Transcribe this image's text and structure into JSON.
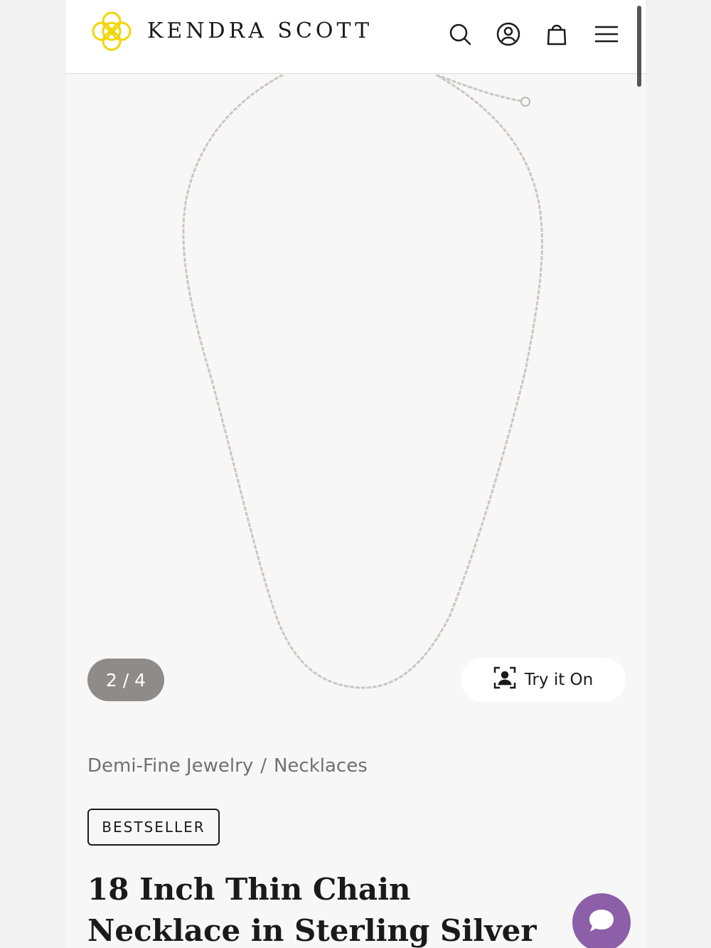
{
  "header": {
    "brand": "KENDRA SCOTT",
    "logo_color": "#f2d600",
    "icons": [
      "search-icon",
      "account-icon",
      "shopping-bag-icon",
      "menu-icon"
    ]
  },
  "gallery": {
    "counter": "2 / 4",
    "try_on_label": "Try it On"
  },
  "breadcrumb": {
    "items": [
      "Demi-Fine Jewelry",
      "Necklaces"
    ],
    "separator": "/"
  },
  "product": {
    "badge": "BESTSELLER",
    "title": "18 Inch Thin Chain Necklace in Sterling Silver"
  },
  "chat": {
    "color": "#8c5fa8"
  }
}
